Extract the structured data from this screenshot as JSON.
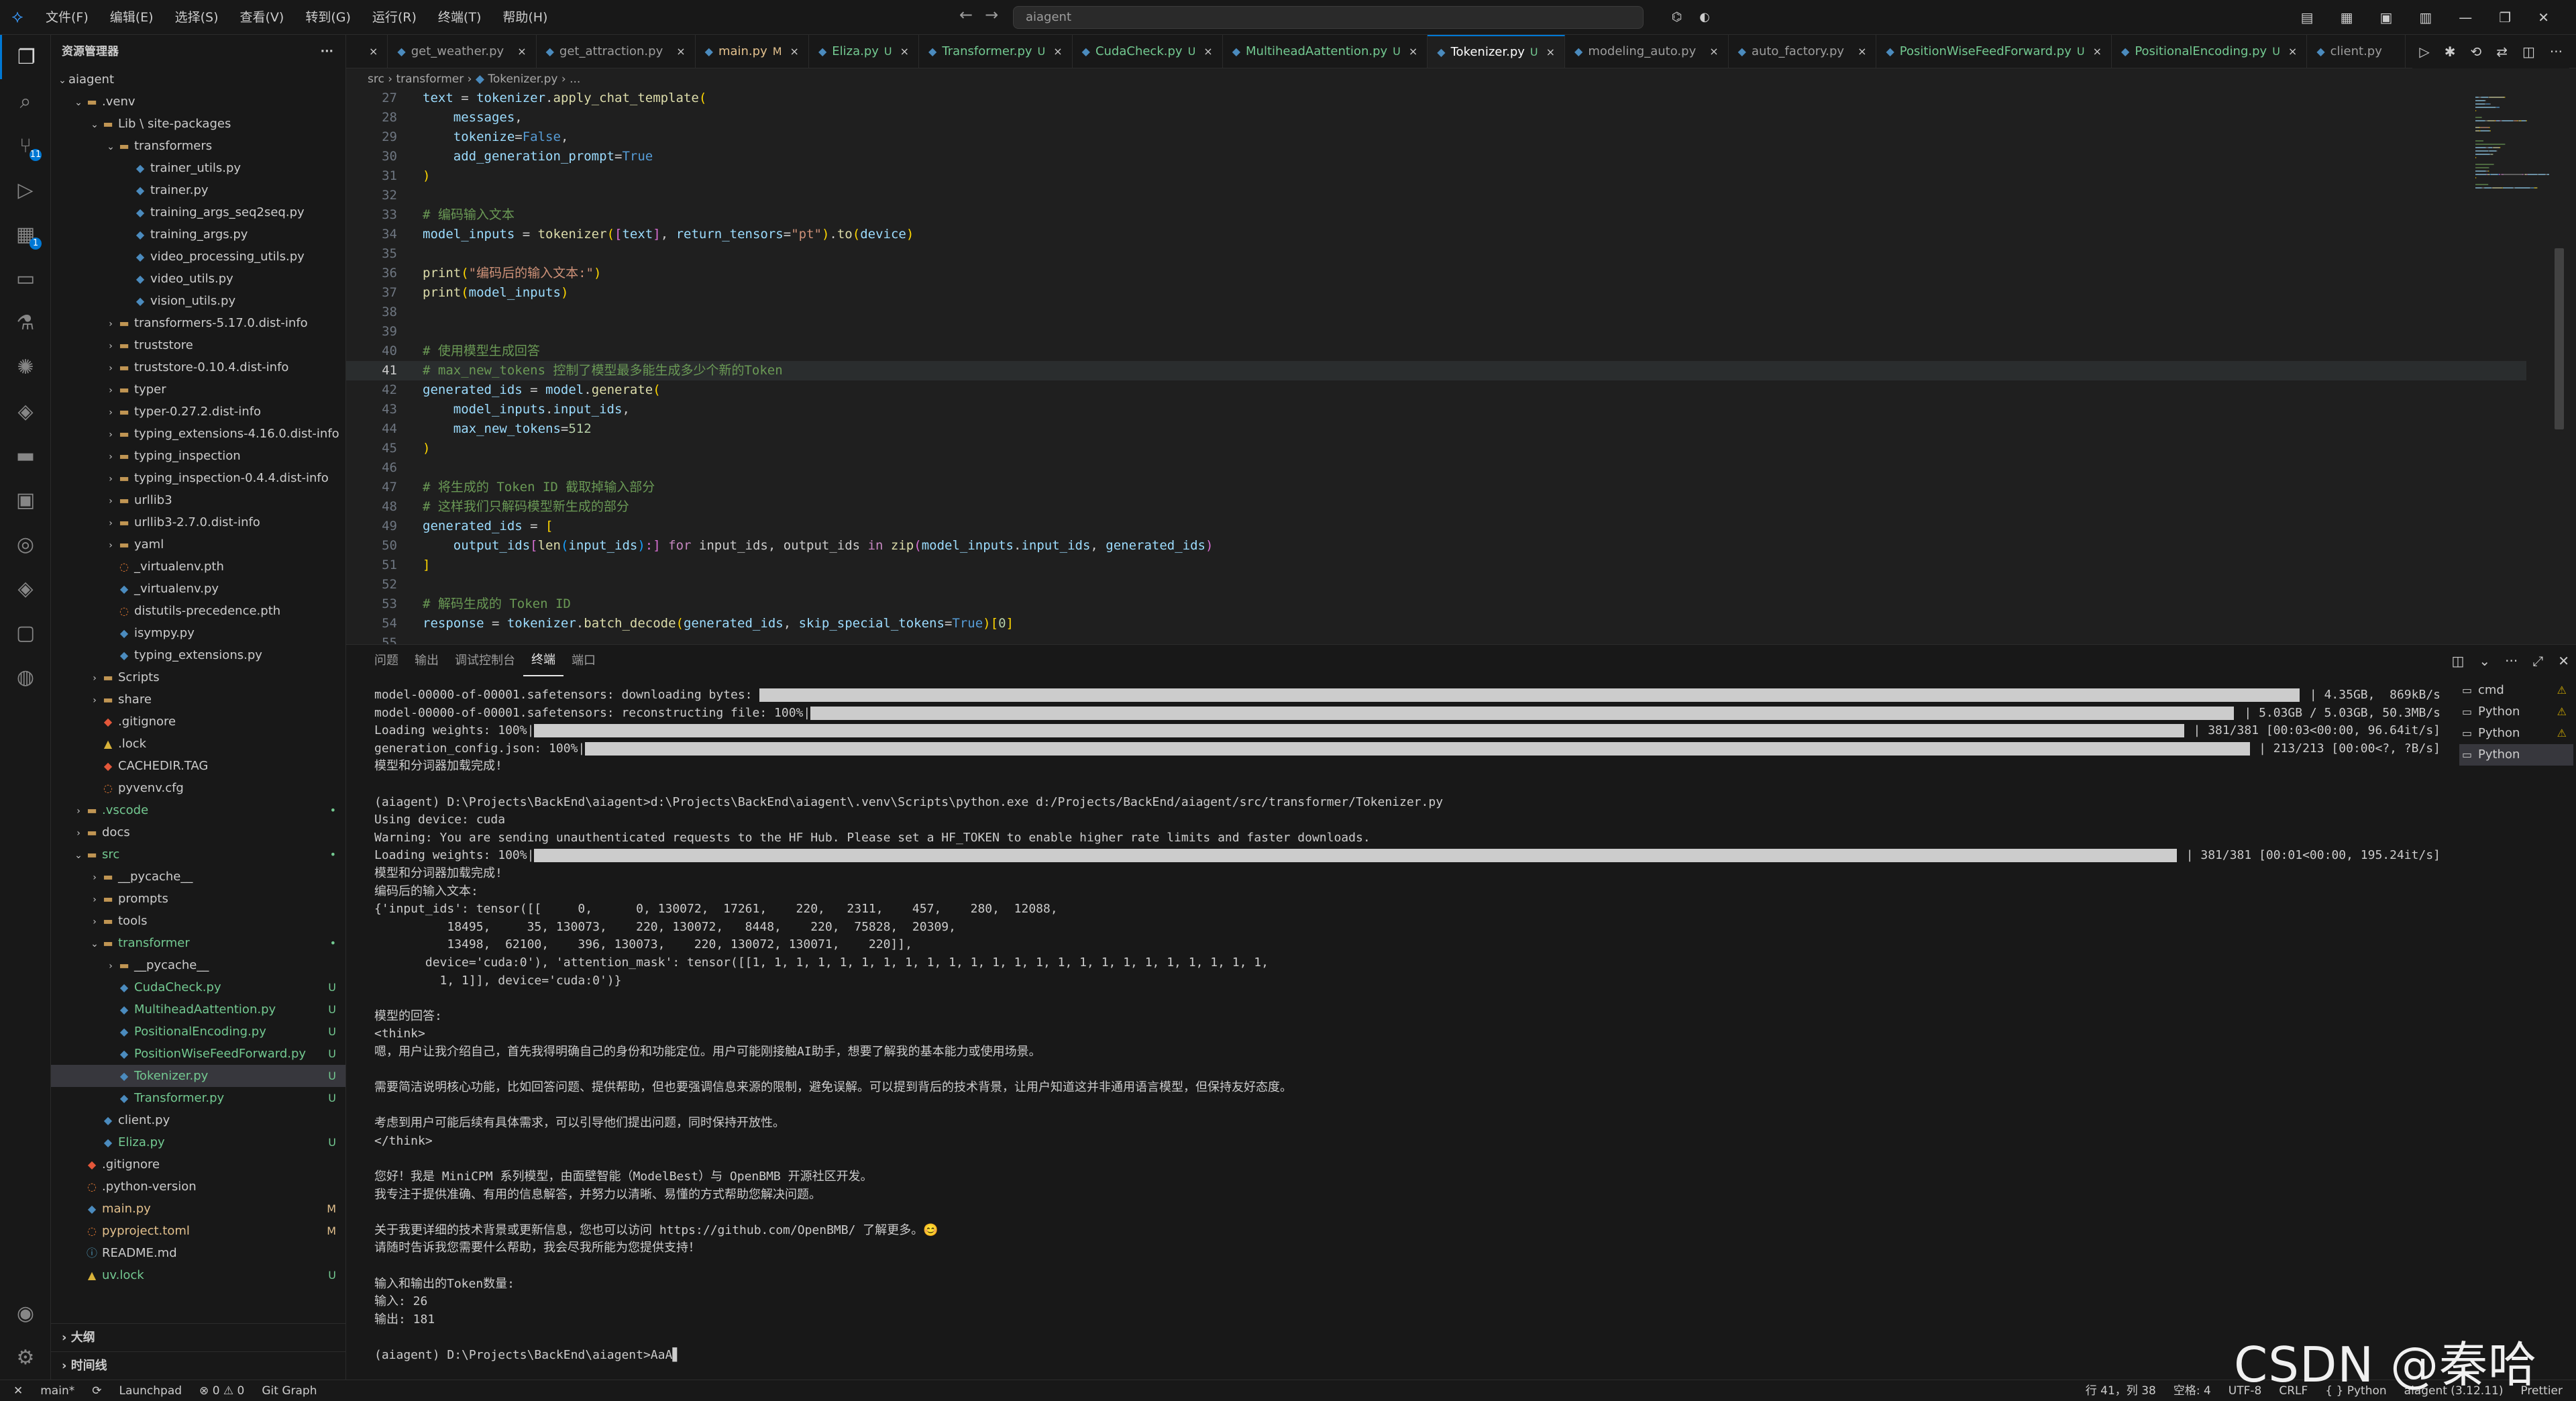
{
  "titlebar": {
    "menus": [
      "文件(F)",
      "编辑(E)",
      "选择(S)",
      "查看(V)",
      "转到(G)",
      "运行(R)",
      "终端(T)",
      "帮助(H)"
    ],
    "search": "aiagent"
  },
  "activity": {
    "items": [
      "files-icon",
      "search-icon",
      "source-control-icon",
      "run-debug-icon",
      "extensions-icon",
      "remote-icon",
      "testing-icon",
      "copilot-icon",
      "python-icon",
      "folder-icon",
      "docker-icon",
      "git-graph-icon",
      "python-env-icon",
      "container-icon",
      "pylance-icon"
    ],
    "scm_badge": "11",
    "ext_badge": "1"
  },
  "sidebar": {
    "title": "资源管理器",
    "outline": "大纲",
    "timeline": "时间线"
  },
  "tree": [
    {
      "d": 0,
      "t": "v",
      "i": "",
      "n": "aiagent",
      "s": "",
      "c": ""
    },
    {
      "d": 1,
      "t": "v",
      "i": "folder",
      "n": ".venv",
      "s": "",
      "c": ""
    },
    {
      "d": 2,
      "t": "v",
      "i": "folder",
      "n": "Lib \\ site-packages",
      "s": "",
      "c": ""
    },
    {
      "d": 3,
      "t": "v",
      "i": "folder",
      "n": "transformers",
      "s": "",
      "c": ""
    },
    {
      "d": 4,
      "t": "",
      "i": "py",
      "n": "trainer_utils.py",
      "s": "",
      "c": ""
    },
    {
      "d": 4,
      "t": "",
      "i": "py",
      "n": "trainer.py",
      "s": "",
      "c": ""
    },
    {
      "d": 4,
      "t": "",
      "i": "py",
      "n": "training_args_seq2seq.py",
      "s": "",
      "c": ""
    },
    {
      "d": 4,
      "t": "",
      "i": "py",
      "n": "training_args.py",
      "s": "",
      "c": ""
    },
    {
      "d": 4,
      "t": "",
      "i": "py",
      "n": "video_processing_utils.py",
      "s": "",
      "c": ""
    },
    {
      "d": 4,
      "t": "",
      "i": "py",
      "n": "video_utils.py",
      "s": "",
      "c": ""
    },
    {
      "d": 4,
      "t": "",
      "i": "py",
      "n": "vision_utils.py",
      "s": "",
      "c": ""
    },
    {
      "d": 3,
      "t": ">",
      "i": "folder",
      "n": "transformers-5.17.0.dist-info",
      "s": "",
      "c": ""
    },
    {
      "d": 3,
      "t": ">",
      "i": "folder",
      "n": "truststore",
      "s": "",
      "c": ""
    },
    {
      "d": 3,
      "t": ">",
      "i": "folder",
      "n": "truststore-0.10.4.dist-info",
      "s": "",
      "c": ""
    },
    {
      "d": 3,
      "t": ">",
      "i": "folder",
      "n": "typer",
      "s": "",
      "c": ""
    },
    {
      "d": 3,
      "t": ">",
      "i": "folder",
      "n": "typer-0.27.2.dist-info",
      "s": "",
      "c": ""
    },
    {
      "d": 3,
      "t": ">",
      "i": "folder",
      "n": "typing_extensions-4.16.0.dist-info",
      "s": "",
      "c": ""
    },
    {
      "d": 3,
      "t": ">",
      "i": "folder",
      "n": "typing_inspection",
      "s": "",
      "c": ""
    },
    {
      "d": 3,
      "t": ">",
      "i": "folder",
      "n": "typing_inspection-0.4.4.dist-info",
      "s": "",
      "c": ""
    },
    {
      "d": 3,
      "t": ">",
      "i": "folder",
      "n": "urllib3",
      "s": "",
      "c": ""
    },
    {
      "d": 3,
      "t": ">",
      "i": "folder",
      "n": "urllib3-2.7.0.dist-info",
      "s": "",
      "c": ""
    },
    {
      "d": 3,
      "t": ">",
      "i": "folder",
      "n": "yaml",
      "s": "",
      "c": ""
    },
    {
      "d": 3,
      "t": "",
      "i": "cfg",
      "n": "_virtualenv.pth",
      "s": "",
      "c": ""
    },
    {
      "d": 3,
      "t": "",
      "i": "py",
      "n": "_virtualenv.py",
      "s": "",
      "c": ""
    },
    {
      "d": 3,
      "t": "",
      "i": "cfg",
      "n": "distutils-precedence.pth",
      "s": "",
      "c": ""
    },
    {
      "d": 3,
      "t": "",
      "i": "py",
      "n": "isympy.py",
      "s": "",
      "c": ""
    },
    {
      "d": 3,
      "t": "",
      "i": "py",
      "n": "typing_extensions.py",
      "s": "",
      "c": ""
    },
    {
      "d": 2,
      "t": ">",
      "i": "folder",
      "n": "Scripts",
      "s": "",
      "c": ""
    },
    {
      "d": 2,
      "t": ">",
      "i": "folder",
      "n": "share",
      "s": "",
      "c": ""
    },
    {
      "d": 2,
      "t": "",
      "i": "git",
      "n": ".gitignore",
      "s": "",
      "c": ""
    },
    {
      "d": 2,
      "t": "",
      "i": "lock",
      "n": ".lock",
      "s": "",
      "c": ""
    },
    {
      "d": 2,
      "t": "",
      "i": "git",
      "n": "CACHEDIR.TAG",
      "s": "",
      "c": ""
    },
    {
      "d": 2,
      "t": "",
      "i": "cfg",
      "n": "pyvenv.cfg",
      "s": "",
      "c": ""
    },
    {
      "d": 1,
      "t": ">",
      "i": "folder",
      "n": ".vscode",
      "s": "•",
      "c": "green"
    },
    {
      "d": 1,
      "t": ">",
      "i": "folder",
      "n": "docs",
      "s": "",
      "c": ""
    },
    {
      "d": 1,
      "t": "v",
      "i": "folder",
      "n": "src",
      "s": "•",
      "c": "green"
    },
    {
      "d": 2,
      "t": ">",
      "i": "folder",
      "n": "__pycache__",
      "s": "",
      "c": ""
    },
    {
      "d": 2,
      "t": ">",
      "i": "folder",
      "n": "prompts",
      "s": "",
      "c": ""
    },
    {
      "d": 2,
      "t": ">",
      "i": "folder",
      "n": "tools",
      "s": "",
      "c": ""
    },
    {
      "d": 2,
      "t": "v",
      "i": "folder",
      "n": "transformer",
      "s": "•",
      "c": "green"
    },
    {
      "d": 3,
      "t": ">",
      "i": "folder",
      "n": "__pycache__",
      "s": "",
      "c": ""
    },
    {
      "d": 3,
      "t": "",
      "i": "py",
      "n": "CudaCheck.py",
      "s": "U",
      "c": "green"
    },
    {
      "d": 3,
      "t": "",
      "i": "py",
      "n": "MultiheadAattention.py",
      "s": "U",
      "c": "green"
    },
    {
      "d": 3,
      "t": "",
      "i": "py",
      "n": "PositionalEncoding.py",
      "s": "U",
      "c": "green"
    },
    {
      "d": 3,
      "t": "",
      "i": "py",
      "n": "PositionWiseFeedForward.py",
      "s": "U",
      "c": "green"
    },
    {
      "d": 3,
      "t": "",
      "i": "py",
      "n": "Tokenizer.py",
      "s": "U",
      "c": "green",
      "sel": true
    },
    {
      "d": 3,
      "t": "",
      "i": "py",
      "n": "Transformer.py",
      "s": "U",
      "c": "green"
    },
    {
      "d": 2,
      "t": "",
      "i": "py",
      "n": "client.py",
      "s": "",
      "c": ""
    },
    {
      "d": 2,
      "t": "",
      "i": "py",
      "n": "Eliza.py",
      "s": "U",
      "c": "green"
    },
    {
      "d": 1,
      "t": "",
      "i": "git",
      "n": ".gitignore",
      "s": "",
      "c": ""
    },
    {
      "d": 1,
      "t": "",
      "i": "cfg",
      "n": ".python-version",
      "s": "",
      "c": ""
    },
    {
      "d": 1,
      "t": "",
      "i": "py",
      "n": "main.py",
      "s": "M",
      "c": "yellow"
    },
    {
      "d": 1,
      "t": "",
      "i": "cfg",
      "n": "pyproject.toml",
      "s": "M",
      "c": "yellow"
    },
    {
      "d": 1,
      "t": "",
      "i": "md",
      "n": "README.md",
      "s": "",
      "c": ""
    },
    {
      "d": 1,
      "t": "",
      "i": "lock",
      "n": "uv.lock",
      "s": "U",
      "c": "green"
    }
  ],
  "tabs": [
    {
      "n": "",
      "f": "",
      "c": "",
      "x": "×"
    },
    {
      "n": "get_weather.py",
      "f": "",
      "c": "",
      "x": "×"
    },
    {
      "n": "get_attraction.py",
      "f": "",
      "c": "",
      "x": "×"
    },
    {
      "n": "main.py",
      "f": "M",
      "c": "yellow",
      "x": "×"
    },
    {
      "n": "Eliza.py",
      "f": "U",
      "c": "green",
      "x": "×"
    },
    {
      "n": "Transformer.py",
      "f": "U",
      "c": "green",
      "x": "×"
    },
    {
      "n": "CudaCheck.py",
      "f": "U",
      "c": "green",
      "x": "×"
    },
    {
      "n": "MultiheadAattention.py",
      "f": "U",
      "c": "green",
      "x": "×"
    },
    {
      "n": "Tokenizer.py",
      "f": "U",
      "c": "green",
      "x": "×",
      "active": true
    },
    {
      "n": "modeling_auto.py",
      "f": "",
      "c": "",
      "x": "×"
    },
    {
      "n": "auto_factory.py",
      "f": "",
      "c": "",
      "x": "×"
    },
    {
      "n": "PositionWiseFeedForward.py",
      "f": "U",
      "c": "green",
      "x": "×"
    },
    {
      "n": "PositionalEncoding.py",
      "f": "U",
      "c": "green",
      "x": "×"
    },
    {
      "n": "client.py",
      "f": "",
      "c": "",
      "x": ""
    }
  ],
  "breadcrumb": [
    "src",
    "transformer",
    "Tokenizer.py",
    "..."
  ],
  "code": [
    {
      "n": "27",
      "s": [
        [
          "text",
          "#9cdcfe"
        ],
        [
          " = ",
          ""
        ],
        [
          "tokenizer",
          "#9cdcfe"
        ],
        [
          ".",
          ""
        ],
        [
          "apply_chat_template",
          "#dcdcaa"
        ],
        [
          "(",
          "#ffd700"
        ]
      ]
    },
    {
      "n": "28",
      "s": [
        [
          "    messages",
          "#9cdcfe"
        ],
        [
          ",",
          ""
        ]
      ]
    },
    {
      "n": "29",
      "s": [
        [
          "    tokenize",
          "#9cdcfe"
        ],
        [
          "=",
          ""
        ],
        [
          "False",
          "#569cd6"
        ],
        [
          ",",
          ""
        ]
      ]
    },
    {
      "n": "30",
      "s": [
        [
          "    add_generation_prompt",
          "#9cdcfe"
        ],
        [
          "=",
          ""
        ],
        [
          "True",
          "#569cd6"
        ]
      ]
    },
    {
      "n": "31",
      "s": [
        [
          ")",
          "#ffd700"
        ]
      ]
    },
    {
      "n": "32",
      "s": []
    },
    {
      "n": "33",
      "s": [
        [
          "# 编码输入文本",
          "#6a9955"
        ]
      ]
    },
    {
      "n": "34",
      "s": [
        [
          "model_inputs",
          "#9cdcfe"
        ],
        [
          " = ",
          ""
        ],
        [
          "tokenizer",
          "#dcdcaa"
        ],
        [
          "(",
          "#ffd700"
        ],
        [
          "[",
          "#da70d6"
        ],
        [
          "text",
          "#9cdcfe"
        ],
        [
          "]",
          "#da70d6"
        ],
        [
          ", ",
          ""
        ],
        [
          "return_tensors",
          "#9cdcfe"
        ],
        [
          "=",
          ""
        ],
        [
          "\"pt\"",
          "#ce9178"
        ],
        [
          ")",
          "#ffd700"
        ],
        [
          ".",
          ""
        ],
        [
          "to",
          "#dcdcaa"
        ],
        [
          "(",
          "#ffd700"
        ],
        [
          "device",
          "#9cdcfe"
        ],
        [
          ")",
          "#ffd700"
        ]
      ]
    },
    {
      "n": "35",
      "s": []
    },
    {
      "n": "36",
      "s": [
        [
          "print",
          "#dcdcaa"
        ],
        [
          "(",
          "#ffd700"
        ],
        [
          "\"编码后的输入文本:\"",
          "#ce9178"
        ],
        [
          ")",
          "#ffd700"
        ]
      ]
    },
    {
      "n": "37",
      "s": [
        [
          "print",
          "#dcdcaa"
        ],
        [
          "(",
          "#ffd700"
        ],
        [
          "model_inputs",
          "#9cdcfe"
        ],
        [
          ")",
          "#ffd700"
        ]
      ]
    },
    {
      "n": "38",
      "s": []
    },
    {
      "n": "39",
      "s": []
    },
    {
      "n": "40",
      "s": [
        [
          "# 使用模型生成回答",
          "#6a9955"
        ]
      ]
    },
    {
      "n": "41",
      "s": [
        [
          "# max_new_tokens 控制了模型最多能生成多少个新的Token",
          "#6a9955"
        ]
      ],
      "cur": true
    },
    {
      "n": "42",
      "s": [
        [
          "generated_ids",
          "#9cdcfe"
        ],
        [
          " = ",
          ""
        ],
        [
          "model",
          "#9cdcfe"
        ],
        [
          ".",
          ""
        ],
        [
          "generate",
          "#dcdcaa"
        ],
        [
          "(",
          "#ffd700"
        ]
      ]
    },
    {
      "n": "43",
      "s": [
        [
          "    model_inputs",
          "#9cdcfe"
        ],
        [
          ".",
          ""
        ],
        [
          "input_ids",
          "#9cdcfe"
        ],
        [
          ",",
          ""
        ]
      ]
    },
    {
      "n": "44",
      "s": [
        [
          "    max_new_tokens",
          "#9cdcfe"
        ],
        [
          "=",
          ""
        ],
        [
          "512",
          "#b5cea8"
        ]
      ]
    },
    {
      "n": "45",
      "s": [
        [
          ")",
          "#ffd700"
        ]
      ]
    },
    {
      "n": "46",
      "s": []
    },
    {
      "n": "47",
      "s": [
        [
          "# 将生成的 Token ID 截取掉输入部分",
          "#6a9955"
        ]
      ]
    },
    {
      "n": "48",
      "s": [
        [
          "# 这样我们只解码模型新生成的部分",
          "#6a9955"
        ]
      ]
    },
    {
      "n": "49",
      "s": [
        [
          "generated_ids",
          "#9cdcfe"
        ],
        [
          " = ",
          ""
        ],
        [
          "[",
          "#ffd700"
        ]
      ]
    },
    {
      "n": "50",
      "s": [
        [
          "    output_ids",
          "#9cdcfe"
        ],
        [
          "[",
          "#da70d6"
        ],
        [
          "len",
          "#dcdcaa"
        ],
        [
          "(",
          "#179fff"
        ],
        [
          "input_ids",
          "#9cdcfe"
        ],
        [
          ")",
          "#179fff"
        ],
        [
          ":]",
          "#da70d6"
        ],
        [
          " ",
          ""
        ],
        [
          "for",
          "#c586c0"
        ],
        [
          " input_ids, output_ids ",
          ""
        ],
        [
          "in",
          "#c586c0"
        ],
        [
          " ",
          ""
        ],
        [
          "zip",
          "#dcdcaa"
        ],
        [
          "(",
          "#da70d6"
        ],
        [
          "model_inputs",
          "#9cdcfe"
        ],
        [
          ".",
          ""
        ],
        [
          "input_ids",
          "#9cdcfe"
        ],
        [
          ", ",
          ""
        ],
        [
          "generated_ids",
          "#9cdcfe"
        ],
        [
          ")",
          "#da70d6"
        ]
      ]
    },
    {
      "n": "51",
      "s": [
        [
          "]",
          "#ffd700"
        ]
      ]
    },
    {
      "n": "52",
      "s": []
    },
    {
      "n": "53",
      "s": [
        [
          "# 解码生成的 Token ID",
          "#6a9955"
        ]
      ]
    },
    {
      "n": "54",
      "s": [
        [
          "response",
          "#9cdcfe"
        ],
        [
          " = ",
          ""
        ],
        [
          "tokenizer",
          "#9cdcfe"
        ],
        [
          ".",
          ""
        ],
        [
          "batch_decode",
          "#dcdcaa"
        ],
        [
          "(",
          "#ffd700"
        ],
        [
          "generated_ids",
          "#9cdcfe"
        ],
        [
          ", ",
          ""
        ],
        [
          "skip_special_tokens",
          "#9cdcfe"
        ],
        [
          "=",
          ""
        ],
        [
          "True",
          "#569cd6"
        ],
        [
          ")",
          "#ffd700"
        ],
        [
          "[",
          "#ffd700"
        ],
        [
          "0",
          "#b5cea8"
        ],
        [
          "]",
          "#ffd700"
        ]
      ]
    },
    {
      "n": "55",
      "s": []
    }
  ],
  "panel": {
    "tabs": [
      "问题",
      "输出",
      "调试控制台",
      "终端",
      "端口"
    ],
    "active_tab": 3,
    "terminals": [
      {
        "n": "cmd",
        "w": "⚠"
      },
      {
        "n": "Python",
        "w": "⚠"
      },
      {
        "n": "Python",
        "w": "⚠"
      },
      {
        "n": "Python",
        "w": "",
        "active": true
      }
    ]
  },
  "terminal": [
    {
      "t": "model-00000-of-00001.safetensors: downloading bytes: ",
      "bar": 0.9,
      "r": "| 4.35GB,  869kB/s"
    },
    {
      "t": "model-00000-of-00001.safetensors: reconstructing file: 100%|",
      "bar": 0.82,
      "r": "| 5.03GB / 5.03GB, 50.3MB/s"
    },
    {
      "t": "Loading weights: 100%|",
      "bar": 0.98,
      "r": "| 381/381 [00:03<00:00, 96.64it/s]"
    },
    {
      "t": "generation_config.json: 100%|",
      "bar": 0.96,
      "r": "| 213/213 [00:00<?, ?B/s]"
    },
    {
      "t": "模型和分词器加载完成!"
    },
    {
      "t": ""
    },
    {
      "t": "(aiagent) D:\\Projects\\BackEnd\\aiagent>d:\\Projects\\BackEnd\\aiagent\\.venv\\Scripts\\python.exe d:/Projects/BackEnd/aiagent/src/transformer/Tokenizer.py"
    },
    {
      "t": "Using device: cuda"
    },
    {
      "t": "Warning: You are sending unauthenticated requests to the HF Hub. Please set a HF_TOKEN to enable higher rate limits and faster downloads."
    },
    {
      "t": "Loading weights: 100%|",
      "bar": 0.97,
      "r": "| 381/381 [00:01<00:00, 195.24it/s]"
    },
    {
      "t": "模型和分词器加载完成!"
    },
    {
      "t": "编码后的输入文本:"
    },
    {
      "t": "{'input_ids': tensor([[     0,      0, 130072,  17261,    220,   2311,    457,    280,  12088,"
    },
    {
      "t": "          18495,     35, 130073,    220, 130072,   8448,    220,  75828,  20309,"
    },
    {
      "t": "          13498,  62100,    396, 130073,    220, 130072, 130071,    220]],"
    },
    {
      "t": "       device='cuda:0'), 'attention_mask': tensor([[1, 1, 1, 1, 1, 1, 1, 1, 1, 1, 1, 1, 1, 1, 1, 1, 1, 1, 1, 1, 1, 1, 1, 1,"
    },
    {
      "t": "         1, 1]], device='cuda:0')}"
    },
    {
      "t": ""
    },
    {
      "t": "模型的回答:"
    },
    {
      "t": "<think>"
    },
    {
      "t": "嗯，用户让我介绍自己，首先我得明确自己的身份和功能定位。用户可能刚接触AI助手，想要了解我的基本能力或使用场景。"
    },
    {
      "t": ""
    },
    {
      "t": "需要简洁说明核心功能，比如回答问题、提供帮助，但也要强调信息来源的限制，避免误解。可以提到背后的技术背景，让用户知道这并非通用语言模型，但保持友好态度。"
    },
    {
      "t": ""
    },
    {
      "t": "考虑到用户可能后续有具体需求，可以引导他们提出问题，同时保持开放性。"
    },
    {
      "t": "</think>"
    },
    {
      "t": ""
    },
    {
      "t": "您好！我是 MiniCPM 系列模型，由面壁智能（ModelBest）与 OpenBMB 开源社区开发。"
    },
    {
      "t": "我专注于提供准确、有用的信息解答，并努力以清晰、易懂的方式帮助您解决问题。"
    },
    {
      "t": ""
    },
    {
      "t": "关于我更详细的技术背景或更新信息，您也可以访问 https://github.com/OpenBMB/ 了解更多。😊"
    },
    {
      "t": "请随时告诉我您需要什么帮助，我会尽我所能为您提供支持！"
    },
    {
      "t": ""
    },
    {
      "t": "输入和输出的Token数量:"
    },
    {
      "t": "输入: 26"
    },
    {
      "t": "输出: 181"
    },
    {
      "t": ""
    },
    {
      "t": "(aiagent) D:\\Projects\\BackEnd\\aiagent>AaA▋"
    }
  ],
  "status": {
    "left": [
      "✕",
      "main*",
      "⟳",
      "Launchpad",
      "⊗ 0 ⚠ 0",
      "Git Graph"
    ],
    "right": [
      "行 41，列 38",
      "空格: 4",
      "UTF-8",
      "CRLF",
      "{ } Python",
      "aiagent (3.12.11)",
      "Prettier"
    ]
  },
  "watermark": "CSDN @秦哈哈"
}
